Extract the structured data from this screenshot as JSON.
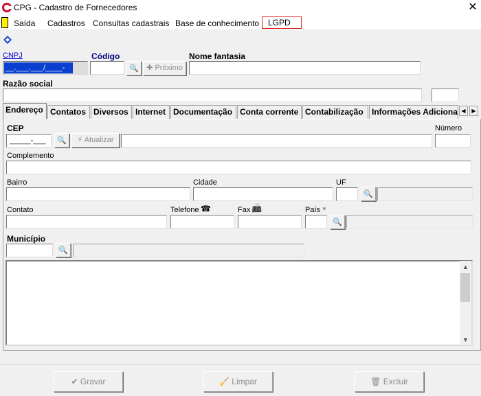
{
  "window": {
    "title": "CPG - Cadastro de Fornecedores",
    "close_glyph": "✕"
  },
  "menu": {
    "items": [
      "Saída",
      "Cadastros",
      "Consultas cadastrais",
      "Base de conhecimento",
      "LGPD"
    ]
  },
  "form": {
    "cnpj_label": "CNPJ",
    "cnpj_value": "__.___.___/____-__",
    "codigo_label": "Código",
    "codigo_value": "",
    "proximo_label": "Próximo",
    "nome_fantasia_label": "Nome fantasia",
    "nome_fantasia_value": "",
    "razao_social_label": "Razão social",
    "razao_social_value": ""
  },
  "tabs": [
    "Endereço",
    "Contatos",
    "Diversos",
    "Internet",
    "Documentação",
    "Conta corrente",
    "Contabilização",
    "Informações Adiciona"
  ],
  "address": {
    "cep_label": "CEP",
    "cep_value": "_____-___",
    "atualizar_label": "Atualizar",
    "numero_label": "Número",
    "complemento_label": "Complemento",
    "bairro_label": "Bairro",
    "cidade_label": "Cidade",
    "uf_label": "UF",
    "contato_label": "Contato",
    "telefone_label": "Telefone",
    "fax_label": "Fax",
    "pais_label": "País",
    "municipio_label": "Município"
  },
  "footer": {
    "gravar_label": "Gravar",
    "limpar_label": "Limpar",
    "excluir_label": "Excluir"
  },
  "colors": {
    "lgpd_highlight": "#e02020",
    "link_blue": "#0000cc",
    "cnpj_field_bg": "#0a3fd0"
  }
}
